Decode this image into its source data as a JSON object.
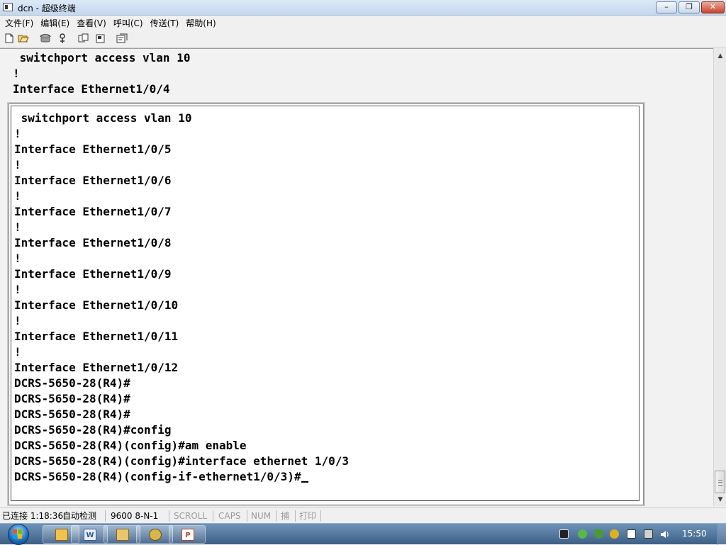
{
  "window": {
    "title": "dcn - 超级终端",
    "min_glyph": "–",
    "max_glyph": "❐",
    "close_glyph": "✕"
  },
  "menu": [
    "文件(F)",
    "编辑(E)",
    "查看(V)",
    "呼叫(C)",
    "传送(T)",
    "帮助(H)"
  ],
  "toolbar": {
    "icons": [
      "new-file-icon",
      "open-folder-icon",
      "phone-icon",
      "disconnect-icon",
      "send-file-icon",
      "receive-file-icon",
      "properties-icon"
    ]
  },
  "terminal": {
    "scrollback_lines": [
      " switchport access vlan 10",
      "!",
      "Interface Ethernet1/0/4"
    ],
    "lines": [
      " switchport access vlan 10",
      "!",
      "Interface Ethernet1/0/5",
      "!",
      "Interface Ethernet1/0/6",
      "!",
      "Interface Ethernet1/0/7",
      "!",
      "Interface Ethernet1/0/8",
      "!",
      "Interface Ethernet1/0/9",
      "!",
      "Interface Ethernet1/0/10",
      "!",
      "Interface Ethernet1/0/11",
      "!",
      "Interface Ethernet1/0/12",
      "DCRS-5650-28(R4)#",
      "DCRS-5650-28(R4)#",
      "DCRS-5650-28(R4)#",
      "DCRS-5650-28(R4)#config",
      "DCRS-5650-28(R4)(config)#am enable",
      "DCRS-5650-28(R4)(config)#interface ethernet 1/0/3",
      "DCRS-5650-28(R4)(config-if-ethernet1/0/3)#"
    ]
  },
  "status": {
    "connection": "已连接 1:18:36",
    "detect": "自动检测",
    "port_settings": "9600 8-N-1",
    "scroll": "SCROLL",
    "caps": "CAPS",
    "num": "NUM",
    "capture": "捕",
    "print": "打印"
  },
  "taskbar": {
    "apps": [
      "folder-app",
      "word-app",
      "explorer-app",
      "network-app",
      "powerpoint-app"
    ],
    "clock": "15:50"
  }
}
